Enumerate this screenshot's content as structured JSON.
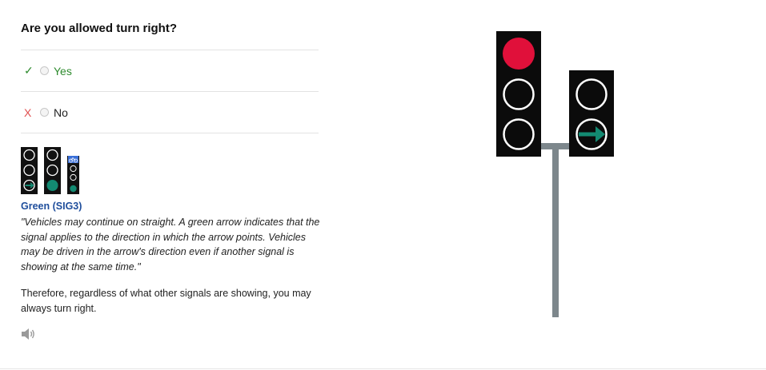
{
  "question": "Are you allowed turn right?",
  "options": [
    {
      "mark": "✓",
      "label": "Yes",
      "correct": true
    },
    {
      "mark": "X",
      "label": "No",
      "correct": false
    }
  ],
  "explanation": {
    "signal_title": "Green (SIG3)",
    "quote": "\"Vehicles may continue on straight. A green arrow indicates that the signal applies to the direction in which the arrow points. Vehicles may be driven in the arrow's direction even if another signal is showing at the same time.\"",
    "conclusion": "Therefore, regardless of what other signals are showing, you may always turn right."
  },
  "icons": {
    "speaker": "speaker-icon",
    "thumbnail_signals": "traffic-signal-thumbnails",
    "main_signal": "traffic-light-illustration"
  },
  "colors": {
    "correct": "#2e8b2e",
    "wrong": "#e05050",
    "link_title": "#1f4e9c",
    "red_light": "#e0103a",
    "green_arrow": "#138a72",
    "pole": "#7d878c"
  }
}
